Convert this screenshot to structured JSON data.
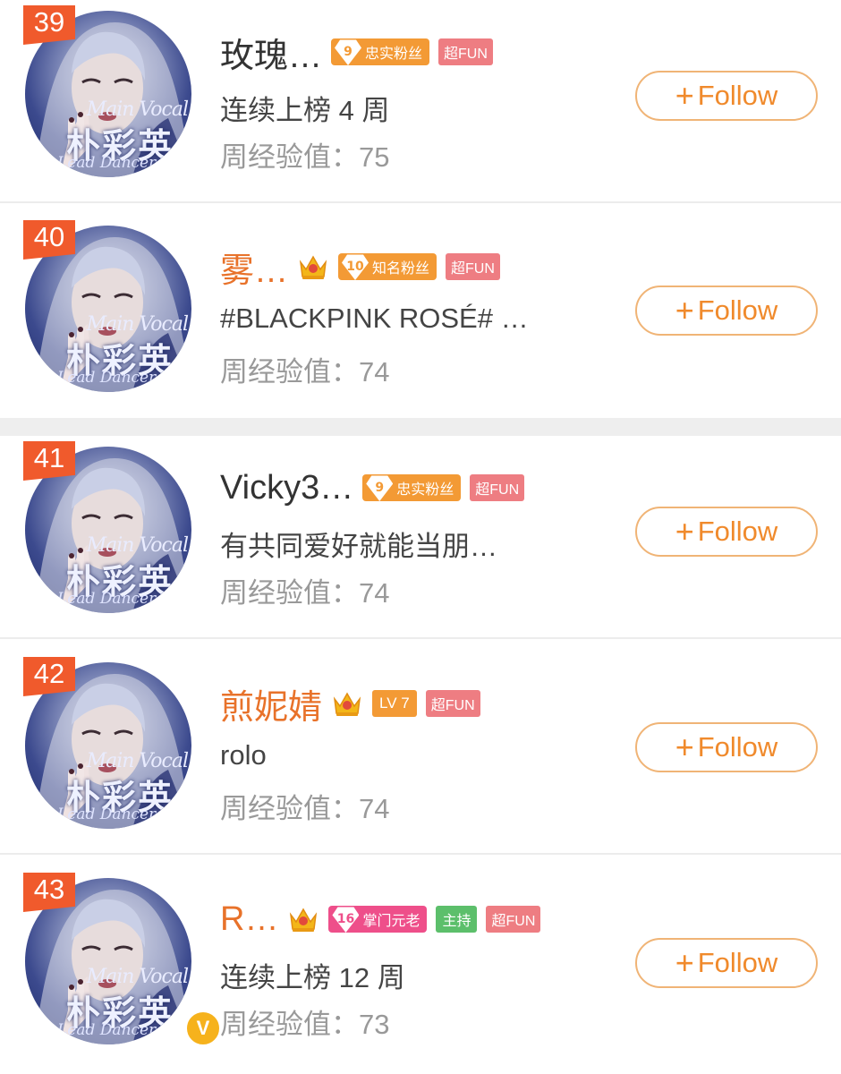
{
  "colors": {
    "rank_badge": "#f05a2c",
    "follow_border": "#f0b476",
    "follow_text": "#f08a2c",
    "name_vip": "#e8722a",
    "fan_badge": "#f39a35",
    "fan_badge_pink": "#ee4f8a",
    "fun_badge": "#ee7d82",
    "host_badge": "#5cbf6b",
    "v_badge": "#f6b21c"
  },
  "avatar": {
    "line1": "Main Vocal",
    "line2": "朴彩英",
    "line3": "Lead Dancer"
  },
  "follow_label": "Follow",
  "follow_icon": "plus-icon",
  "rows": [
    {
      "rank": "39",
      "name": "玫瑰…",
      "vip": false,
      "crown": false,
      "fan_level": "9",
      "fan_title": "忠实粉丝",
      "lv": null,
      "host": null,
      "fun": "超FUN",
      "subtitle": "连续上榜 4 周",
      "exp": "周经验值：75",
      "verified": false
    },
    {
      "rank": "40",
      "name": "雾…",
      "vip": true,
      "crown": true,
      "fan_level": "10",
      "fan_title": "知名粉丝",
      "lv": null,
      "host": null,
      "fun": "超FUN",
      "subtitle": "#BLACKPINK ROSÉ# …",
      "exp": "周经验值：74",
      "verified": false
    },
    {
      "rank": "41",
      "name": "Vicky3…",
      "vip": false,
      "crown": false,
      "fan_level": "9",
      "fan_title": "忠实粉丝",
      "lv": null,
      "host": null,
      "fun": "超FUN",
      "subtitle": "有共同爱好就能当朋…",
      "exp": "周经验值：74",
      "verified": false
    },
    {
      "rank": "42",
      "name": "煎妮婧",
      "vip": true,
      "crown": true,
      "fan_level": null,
      "fan_title": null,
      "lv": "LV 7",
      "host": null,
      "fun": "超FUN",
      "subtitle": "rolo",
      "exp": "周经验值：74",
      "verified": false
    },
    {
      "rank": "43",
      "name": "R…",
      "vip": true,
      "crown": true,
      "fan_level": "16",
      "fan_title": "掌门元老",
      "fan_pink": true,
      "lv": null,
      "host": "主持",
      "fun": "超FUN",
      "subtitle": "连续上榜 12 周",
      "exp": "周经验值：73",
      "verified": true,
      "verified_mark": "V"
    }
  ]
}
